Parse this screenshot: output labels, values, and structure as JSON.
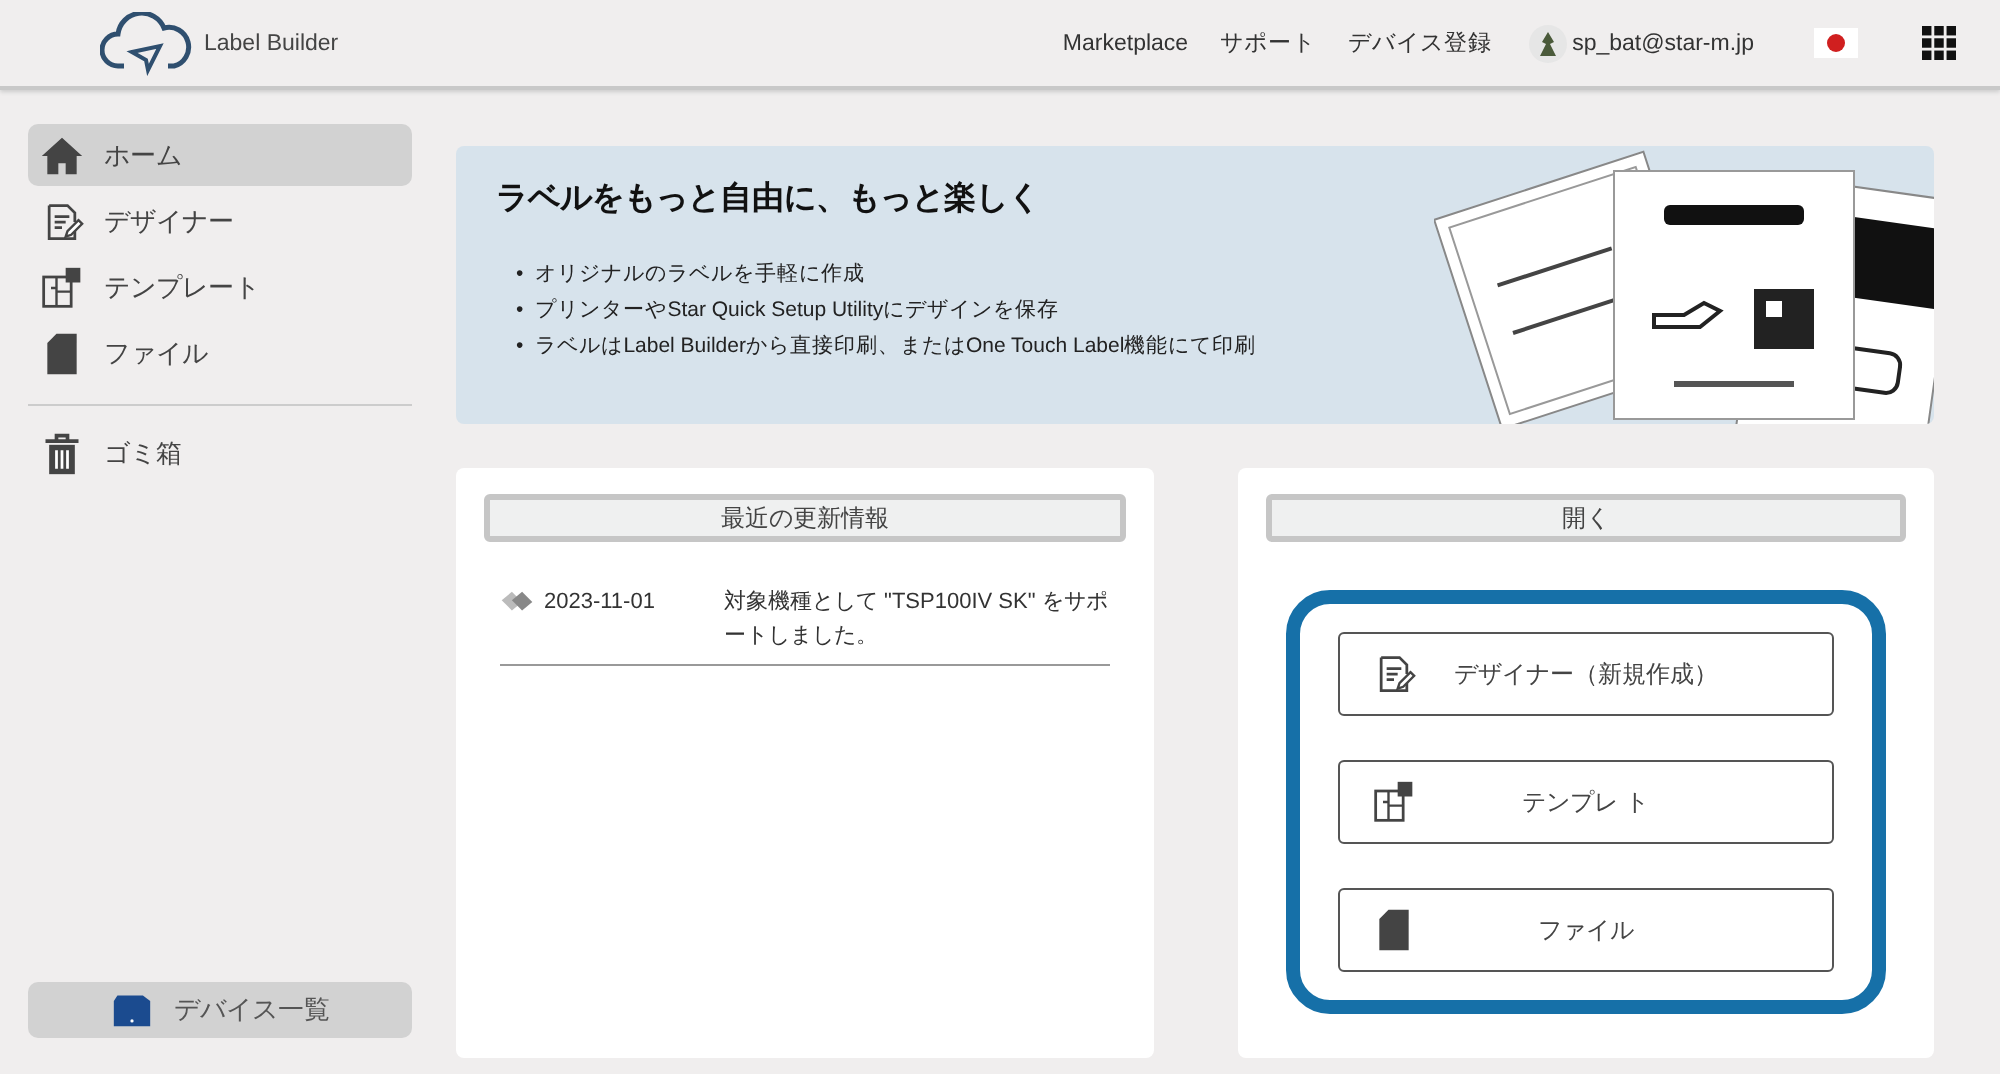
{
  "header": {
    "app_name": "Label Builder",
    "links": [
      "Marketplace",
      "サポート",
      "デバイス登録"
    ],
    "user": "sp_bat@star-m.jp"
  },
  "sidebar": {
    "items": [
      {
        "label": "ホーム",
        "kind": "home",
        "selected": true
      },
      {
        "label": "デザイナー",
        "kind": "designer",
        "selected": false
      },
      {
        "label": "テンプレート",
        "kind": "template",
        "selected": false
      },
      {
        "label": "ファイル",
        "kind": "file",
        "selected": false
      }
    ],
    "trash": {
      "label": "ゴミ箱"
    },
    "device_button": {
      "label": "デバイス一覧"
    }
  },
  "banner": {
    "title": "ラベルをもっと自由に、もっと楽しく",
    "bullets": [
      {
        "marker": "•",
        "text": "オリジナルのラベルを手軽に作成"
      },
      {
        "marker": "•",
        "text": "プリンターやStar Quick Setup Utilityにデザインを保存"
      },
      {
        "marker": "•",
        "text": "ラベルはLabel Builderから直接印刷、またはOne Touch Label機能にて印刷"
      }
    ]
  },
  "updates": {
    "title": "最近の更新情報",
    "items": [
      {
        "date": "2023-11-01",
        "text": "対象機種として \"TSP100IV SK\" をサポートしました。"
      }
    ]
  },
  "open": {
    "title": "開く",
    "buttons": [
      {
        "label": "デザイナー（新規作成）",
        "kind": "designer"
      },
      {
        "label": "テンプレ ト",
        "kind": "template"
      },
      {
        "label": "ファイル",
        "kind": "file"
      }
    ]
  }
}
